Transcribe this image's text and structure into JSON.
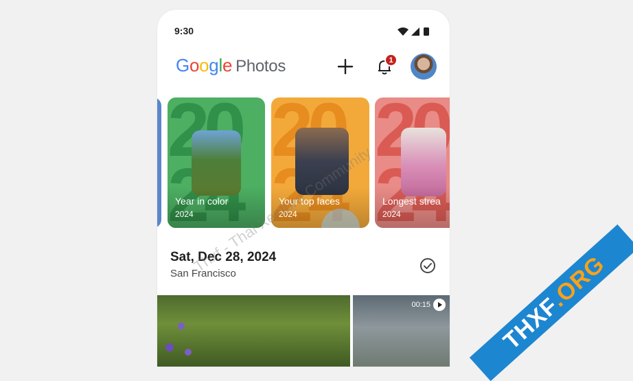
{
  "status_bar": {
    "time": "9:30"
  },
  "header": {
    "logo_google": [
      "G",
      "o",
      "o",
      "g",
      "l",
      "e"
    ],
    "logo_google_colors": [
      "#4285F4",
      "#EA4335",
      "#FBBC05",
      "#4285F4",
      "#34A853",
      "#EA4335"
    ],
    "logo_photos": "Photos",
    "notification_count": "1"
  },
  "memories": [
    {
      "title": "Year in color",
      "year": "2024",
      "bg": "#4caf62",
      "big": "#2f8d47"
    },
    {
      "title": "Your top faces",
      "year": "2024",
      "bg": "#f3a93a",
      "big": "#e6891c"
    },
    {
      "title": "Longest strea",
      "year": "2024",
      "bg": "#e98b86",
      "big": "#d9564f"
    }
  ],
  "day_section": {
    "date": "Sat, Dec 28, 2024",
    "location": "San Francisco"
  },
  "video": {
    "duration": "00:15"
  },
  "watermark": {
    "text": "Thxf - Thai Xenforo Community",
    "brand": "THXF",
    "brand_suffix": ".ORG"
  }
}
